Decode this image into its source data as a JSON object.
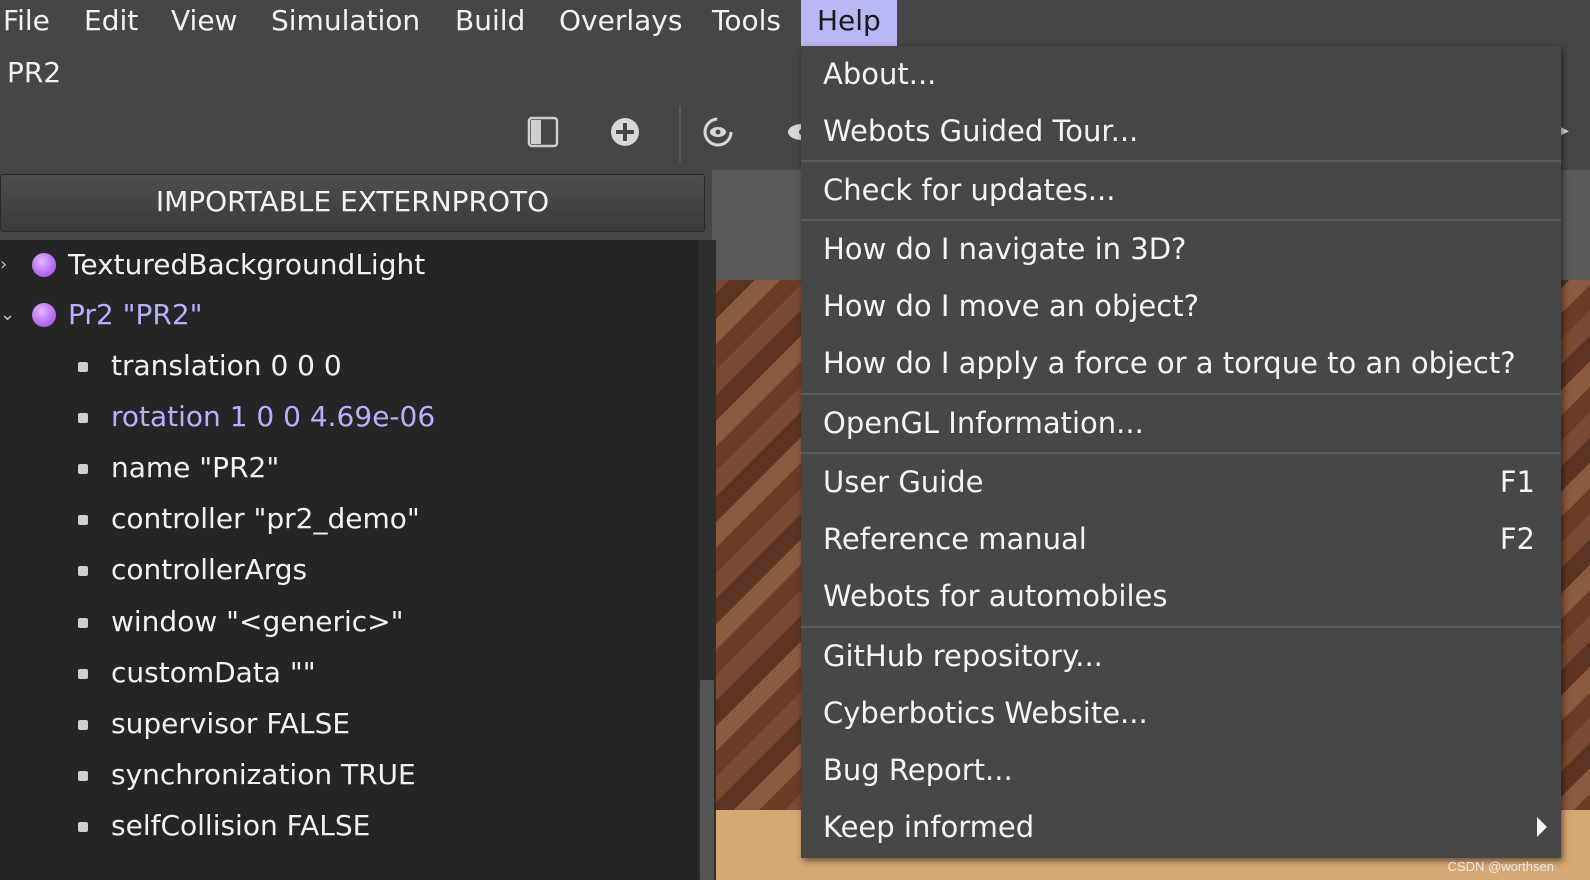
{
  "menubar": {
    "items": [
      {
        "label": "File"
      },
      {
        "label": "Edit"
      },
      {
        "label": "View"
      },
      {
        "label": "Simulation"
      },
      {
        "label": "Build"
      },
      {
        "label": "Overlays"
      },
      {
        "label": "Tools"
      },
      {
        "label": "Help",
        "active": true
      }
    ]
  },
  "document": {
    "title": "PR2"
  },
  "toolbar": {
    "icons": [
      "panel-toggle-icon",
      "add-node-icon",
      "reset-view-icon",
      "visibility-icon"
    ]
  },
  "scene_tree": {
    "header": "IMPORTABLE EXTERNPROTO",
    "nodes": [
      {
        "label": "TexturedBackgroundLight",
        "expanded": false
      },
      {
        "label": "Pr2 \"PR2\"",
        "expanded": true,
        "selected": true
      }
    ],
    "fields": [
      {
        "label": "translation 0 0 0"
      },
      {
        "label": "rotation 1 0 0 4.69e-06",
        "selected": true
      },
      {
        "label": "name \"PR2\""
      },
      {
        "label": "controller \"pr2_demo\""
      },
      {
        "label": "controllerArgs"
      },
      {
        "label": "window \"<generic>\""
      },
      {
        "label": "customData \"\""
      },
      {
        "label": "supervisor FALSE"
      },
      {
        "label": "synchronization TRUE"
      },
      {
        "label": "selfCollision FALSE"
      }
    ]
  },
  "help_menu": {
    "items": [
      {
        "label": "About..."
      },
      {
        "label": "Webots Guided Tour..."
      },
      {
        "label": "Check for updates..."
      },
      {
        "label": "How do I navigate in 3D?"
      },
      {
        "label": "How do I move an object?"
      },
      {
        "label": "How do I apply a force or a torque to an object?"
      },
      {
        "label": "OpenGL Information..."
      },
      {
        "label": "User Guide",
        "shortcut": "F1"
      },
      {
        "label": "Reference manual",
        "shortcut": "F2"
      },
      {
        "label": "Webots for automobiles"
      },
      {
        "label": "GitHub repository..."
      },
      {
        "label": "Cyberbotics Website..."
      },
      {
        "label": "Bug Report..."
      },
      {
        "label": "Keep informed",
        "submenu": true
      }
    ]
  },
  "watermark": "CSDN @worthsen",
  "colors": {
    "menu_active_bg": "#b8b7f3",
    "selected_text": "#b5b1ff",
    "node_dot": "#b66bf0",
    "background": "#464646",
    "tree_bg": "#252525"
  }
}
